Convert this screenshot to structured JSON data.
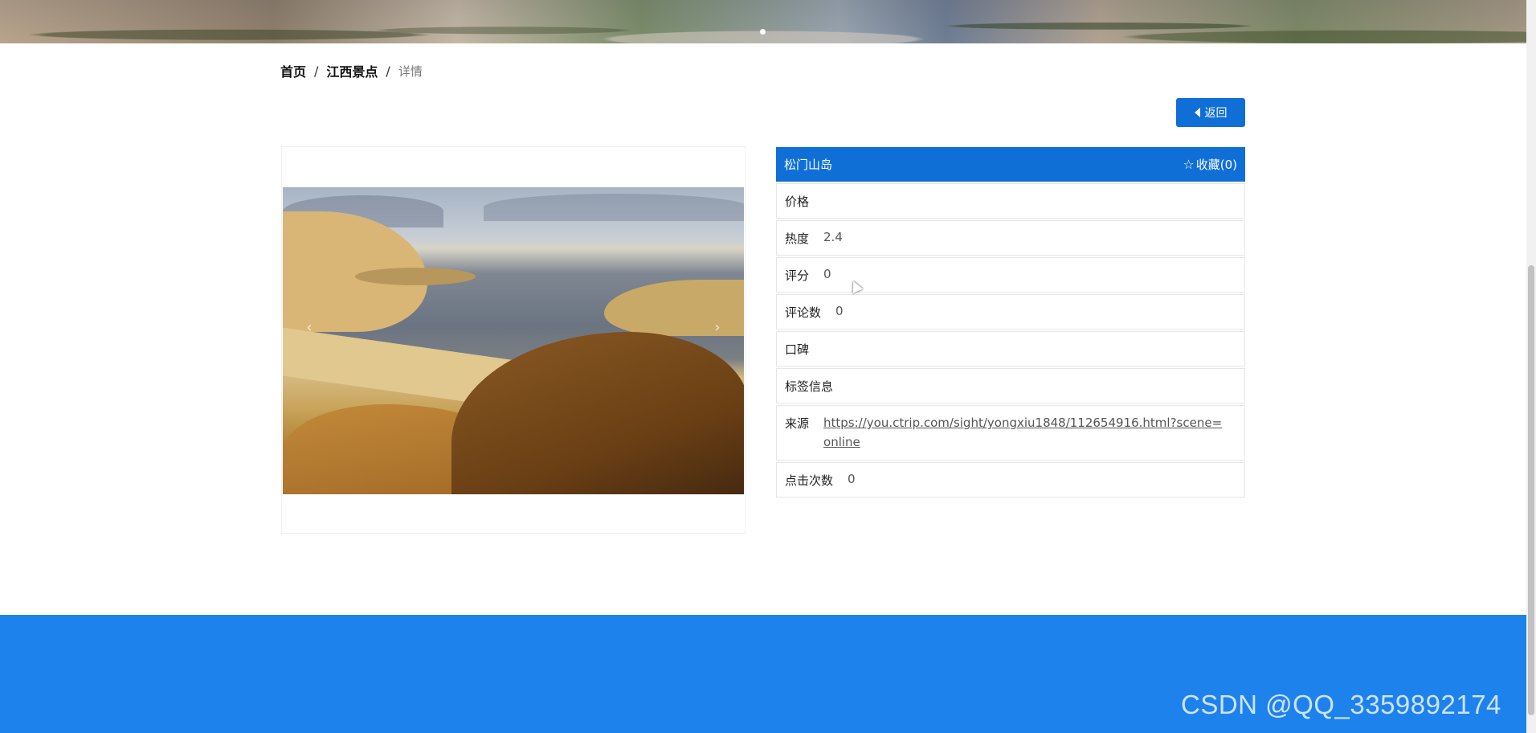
{
  "breadcrumb": {
    "home": "首页",
    "section": "江西景点",
    "current": "详情",
    "separator": "/"
  },
  "back_button": {
    "label": "返回"
  },
  "carousel": {
    "prev_glyph": "‹",
    "next_glyph": "›"
  },
  "detail": {
    "title": "松门山岛",
    "favorite_label": "收藏(0)",
    "rows": [
      {
        "label": "价格",
        "value": ""
      },
      {
        "label": "热度",
        "value": "2.4"
      },
      {
        "label": "评分",
        "value": "0"
      },
      {
        "label": "评论数",
        "value": "0"
      },
      {
        "label": "口碑",
        "value": ""
      },
      {
        "label": "标签信息",
        "value": ""
      },
      {
        "label": "来源",
        "value": "https://you.ctrip.com/sight/yongxiu1848/112654916.html?scene=online"
      },
      {
        "label": "点击次数",
        "value": "0"
      }
    ]
  },
  "watermark": "CSDN @QQ_3359892174",
  "colors": {
    "primary": "#0f6fd7",
    "footer": "#1e82ec"
  }
}
